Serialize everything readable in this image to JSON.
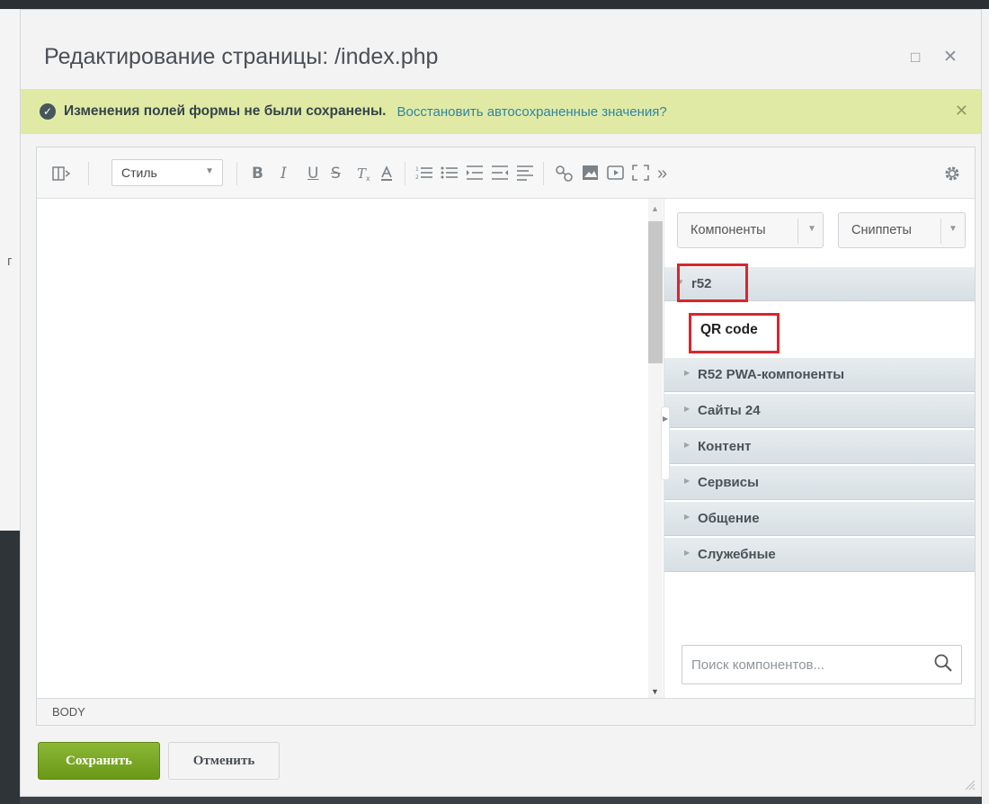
{
  "dialog": {
    "title": "Редактирование страницы: /index.php"
  },
  "notice": {
    "message": "Изменения полей формы не были сохранены.",
    "link": "Восстановить автосохраненные значения?"
  },
  "toolbar": {
    "style_label": "Стиль",
    "bold": "B",
    "italic": "I",
    "underline": "U",
    "strike": "S",
    "expand": "»"
  },
  "panel": {
    "components_label": "Компоненты",
    "snippets_label": "Сниппеты",
    "tree": [
      {
        "label": "r52",
        "expanded": true
      },
      {
        "label": "R52 PWA-компоненты"
      },
      {
        "label": "Сайты 24"
      },
      {
        "label": "Контент"
      },
      {
        "label": "Сервисы"
      },
      {
        "label": "Общение"
      },
      {
        "label": "Служебные"
      }
    ],
    "child_item": "QR code",
    "search_placeholder": "Поиск компонентов..."
  },
  "statusbar": {
    "path": "BODY"
  },
  "footer": {
    "save_label": "Сохранить",
    "cancel_label": "Отменить"
  },
  "colors": {
    "notice_bg": "#e1eaa4",
    "link": "#2e84a6",
    "save_bg": "#7aa526",
    "highlight": "#d9262c"
  }
}
